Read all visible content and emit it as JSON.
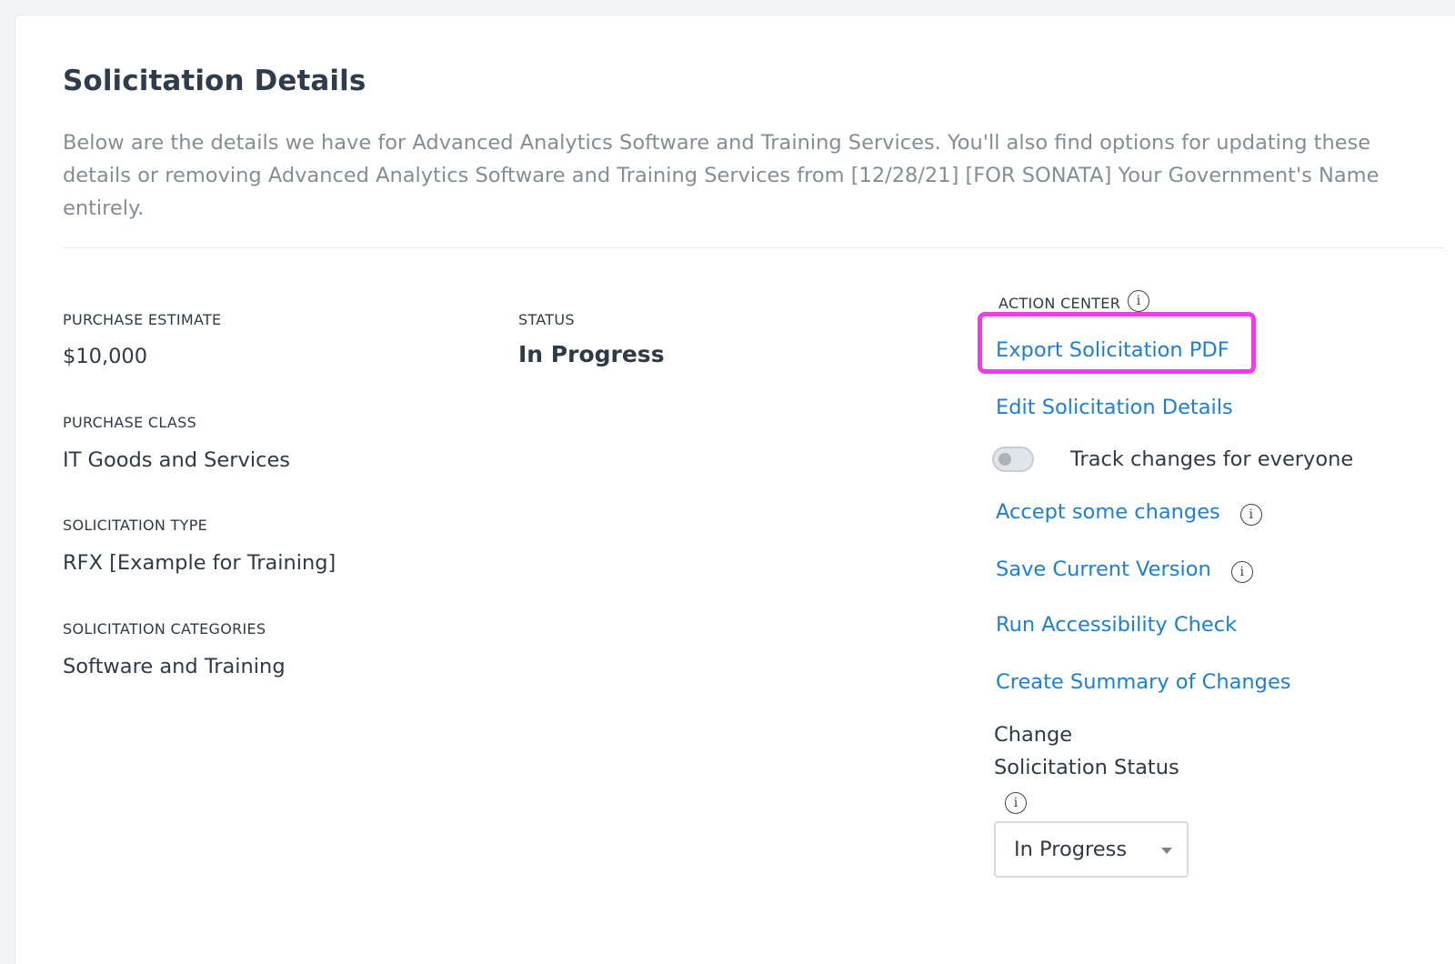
{
  "header": {
    "title": "Solicitation Details",
    "description": "Below are the details we have for Advanced Analytics Software and Training Services. You'll also find options for updating these details or removing Advanced Analytics Software and Training Services from [12/28/21] [FOR SONATA] Your Government's Name entirely."
  },
  "details": {
    "purchase_estimate_label": "PURCHASE ESTIMATE",
    "purchase_estimate_value": "$10,000",
    "purchase_class_label": "PURCHASE CLASS",
    "purchase_class_value": "IT Goods and Services",
    "solicitation_type_label": "SOLICITATION TYPE",
    "solicitation_type_value": "RFX [Example for Training]",
    "solicitation_categories_label": "SOLICITATION CATEGORIES",
    "solicitation_categories_value": "Software and Training",
    "status_label": "STATUS",
    "status_value": "In Progress"
  },
  "action_center": {
    "label": "ACTION CENTER",
    "info_glyph": "i",
    "export_pdf": "Export Solicitation PDF",
    "edit_details": "Edit Solicitation Details",
    "track_changes": {
      "label": "Track changes for everyone",
      "enabled": false
    },
    "accept_changes": "Accept some changes",
    "save_version": "Save Current Version",
    "accessibility_check": "Run Accessibility Check",
    "summary_of_changes": "Create Summary of Changes",
    "change_status_line1": "Change",
    "change_status_line2": "Solicitation Status",
    "status_select_value": "In Progress"
  },
  "colors": {
    "link": "#1b7fd4",
    "highlight": "#f23be8",
    "text": "#2e3a47",
    "muted": "#848c95"
  },
  "icons": [
    "info-icon",
    "chevron-down-icon",
    "toggle-switch"
  ]
}
